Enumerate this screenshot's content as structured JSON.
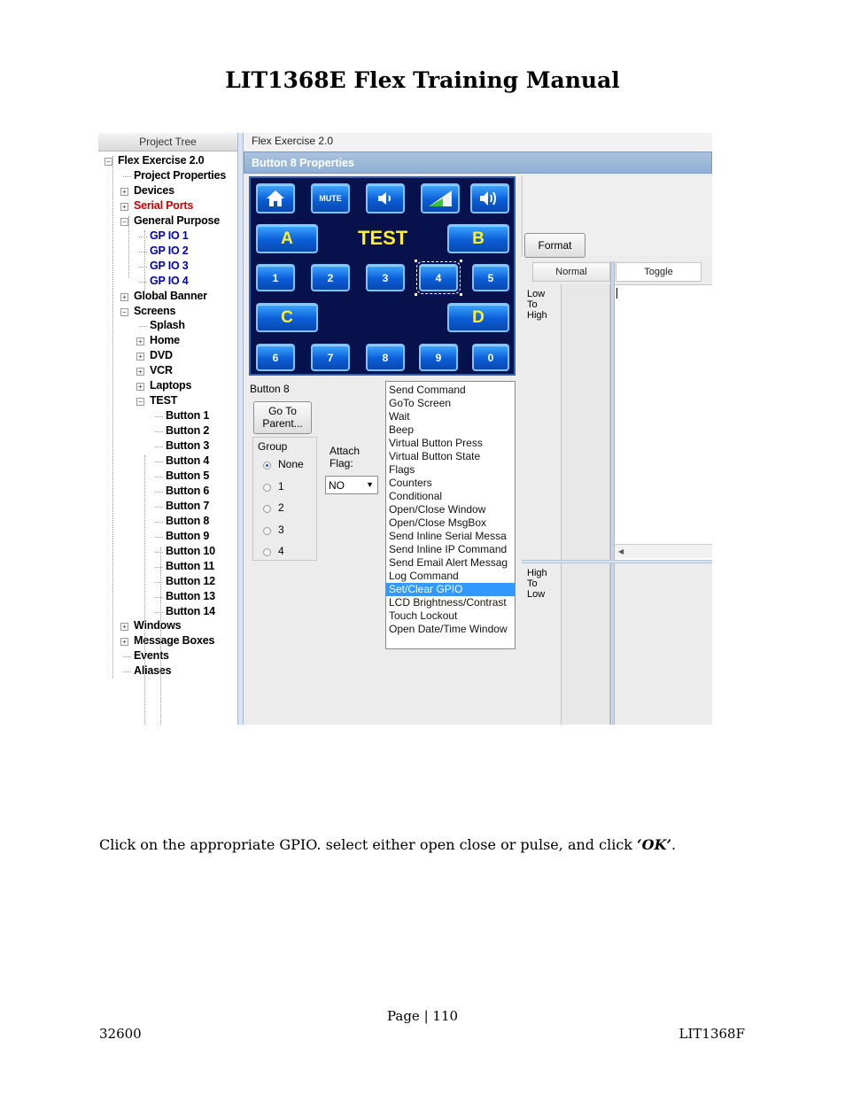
{
  "document": {
    "title": "LIT1368E Flex Training Manual",
    "instruction_prefix": "Click on the appropriate GPIO. select either open close or pulse, and click ",
    "instruction_emphasis": "‘OK’",
    "instruction_suffix": ".",
    "page_label": "Page | 110",
    "footer_left": "32600",
    "footer_right": "LIT1368F"
  },
  "app": {
    "tree_header": "Project Tree",
    "tab_title": "Flex Exercise 2.0",
    "properties_title": "Button 8 Properties",
    "tree": [
      {
        "label": "Flex Exercise 2.0",
        "color": "#000000"
      },
      {
        "label": "Project Properties",
        "color": "#000000"
      },
      {
        "label": "Devices",
        "color": "#000000"
      },
      {
        "label": "Serial Ports",
        "color": "#cc0000"
      },
      {
        "label": "General Purpose",
        "color": "#000000"
      },
      {
        "label": "GP IO 1",
        "color": "#0000b0"
      },
      {
        "label": "GP IO 2",
        "color": "#0000b0"
      },
      {
        "label": "GP IO 3",
        "color": "#0000b0"
      },
      {
        "label": "GP IO 4",
        "color": "#0000b0"
      },
      {
        "label": "Global Banner",
        "color": "#000000"
      },
      {
        "label": "Screens",
        "color": "#000000"
      },
      {
        "label": "Splash",
        "color": "#000000"
      },
      {
        "label": "Home",
        "color": "#000000"
      },
      {
        "label": "DVD",
        "color": "#000000"
      },
      {
        "label": "VCR",
        "color": "#000000"
      },
      {
        "label": "Laptops",
        "color": "#000000"
      },
      {
        "label": "TEST",
        "color": "#000000"
      },
      {
        "label": "Button 1",
        "color": "#000000"
      },
      {
        "label": "Button 2",
        "color": "#000000"
      },
      {
        "label": "Button 3",
        "color": "#000000"
      },
      {
        "label": "Button 4",
        "color": "#000000"
      },
      {
        "label": "Button 5",
        "color": "#000000"
      },
      {
        "label": "Button 6",
        "color": "#000000"
      },
      {
        "label": "Button 7",
        "color": "#000000"
      },
      {
        "label": "Button 8",
        "color": "#000000"
      },
      {
        "label": "Button 9",
        "color": "#000000"
      },
      {
        "label": "Button 10",
        "color": "#000000"
      },
      {
        "label": "Button 11",
        "color": "#000000"
      },
      {
        "label": "Button 12",
        "color": "#000000"
      },
      {
        "label": "Button 13",
        "color": "#000000"
      },
      {
        "label": "Button 14",
        "color": "#000000"
      },
      {
        "label": "Windows",
        "color": "#000000"
      },
      {
        "label": "Message Boxes",
        "color": "#000000"
      },
      {
        "label": "Events",
        "color": "#000000"
      },
      {
        "label": "Aliases",
        "color": "#000000"
      }
    ],
    "panel": {
      "mute_label": "MUTE",
      "letter_a": "A",
      "letter_b": "B",
      "letter_c": "C",
      "letter_d": "D",
      "test_label": "TEST",
      "row1": [
        "1",
        "2",
        "3",
        "4",
        "5"
      ],
      "row2": [
        "6",
        "7",
        "8",
        "9",
        "0"
      ],
      "icons": [
        "home-icon",
        "volume-down-icon",
        "signal-level-icon",
        "volume-up-icon"
      ],
      "accent": "#0b5ed8",
      "background": "#07124d",
      "test_color": "#ffef2c"
    },
    "button_name": "Button 8",
    "go_to_parent": [
      "Go To",
      "Parent..."
    ],
    "group_label": "Group",
    "group_options": [
      "None",
      "1",
      "2",
      "3",
      "4"
    ],
    "group_selected": "None",
    "attach_flag_label": [
      "Attach",
      "Flag:"
    ],
    "attach_flag_value": "NO",
    "commands": [
      "Send Command",
      "GoTo Screen",
      "Wait",
      "Beep",
      "Virtual Button Press",
      "Virtual Button State",
      "Flags",
      "Counters",
      "Conditional",
      "Open/Close Window",
      "Open/Close MsgBox",
      "Send Inline Serial Messa",
      "Send Inline IP Command",
      "Send Email Alert Messag",
      "Log Command",
      "Set/Clear GPIO",
      "LCD Brightness/Contrast",
      "Touch Lockout",
      "Open Date/Time Window"
    ],
    "selected_command": "Set/Clear GPIO",
    "format_label": "Format",
    "state_headers": [
      "Normal",
      "Toggle"
    ],
    "low_to_high": [
      "Low",
      "To",
      "High"
    ],
    "high_to_low": [
      "High",
      "To",
      "Low"
    ],
    "selection_color": "#3399ff"
  }
}
